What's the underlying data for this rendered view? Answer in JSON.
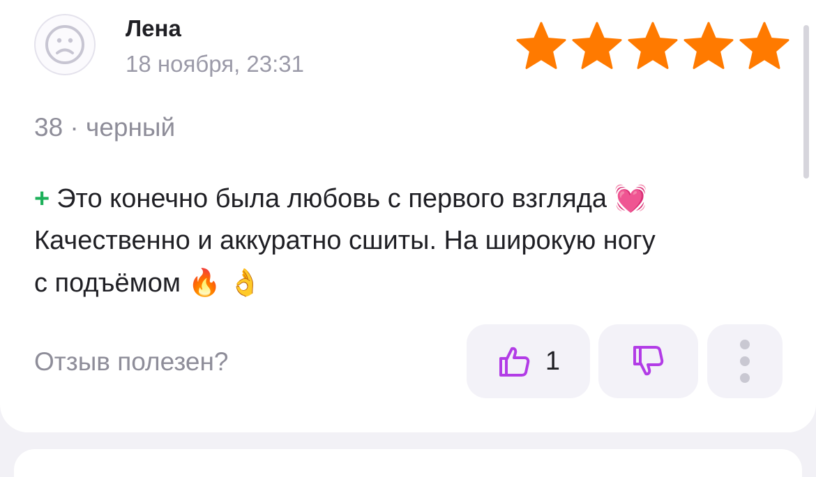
{
  "review": {
    "author_name": "Лена",
    "date": "18 ноября, 23:31",
    "rating": 5,
    "rating_max": 5,
    "variant": "38 · черный",
    "plus_sign": "+",
    "line1": "Это конечно была любовь с первого взгляда",
    "emoji_heart": "💓",
    "line2": "Качественно и аккуратно сшиты. На широкую ногу",
    "line3": "с подъёмом",
    "emoji_fire": "🔥",
    "emoji_ok": "👌"
  },
  "feedback": {
    "question": "Отзыв полезен?",
    "like_count": "1"
  },
  "colors": {
    "star": "#ff7a00",
    "accent_icon": "#b23ce6",
    "plus_green": "#1db05a",
    "muted_text": "#8e8d99",
    "button_bg": "#f3f2f8"
  },
  "icons": {
    "avatar": "sad-face-icon",
    "rating": "star-icon",
    "like": "thumbs-up-icon",
    "dislike": "thumbs-down-icon",
    "more": "more-vertical-icon"
  }
}
